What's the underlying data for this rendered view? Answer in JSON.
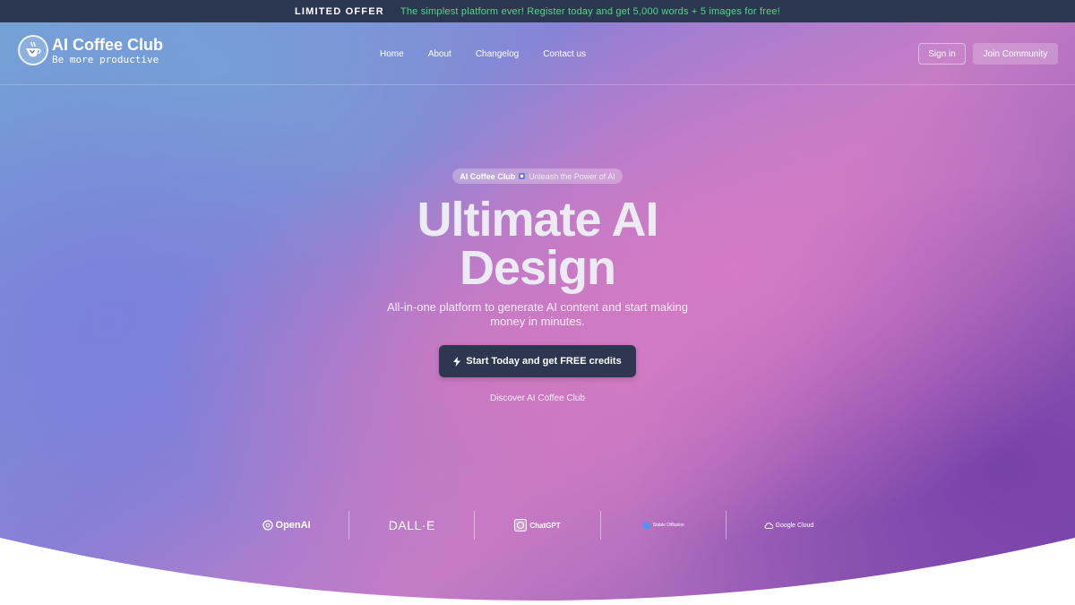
{
  "banner": {
    "offer": "LIMITED OFFER",
    "message": "The simplest platform ever! Register today and get 5,000 words + 5 images for free!"
  },
  "brand": {
    "name": "AI Coffee Club",
    "tagline": "Be more productive"
  },
  "nav": {
    "items": [
      "Home",
      "About",
      "Changelog",
      "Contact us"
    ],
    "sign_in": "Sign in",
    "join": "Join Community"
  },
  "hero": {
    "pill_brand": "AI Coffee Club",
    "pill_text": "Unleash the Power of AI",
    "headline_line1": "Ultimate AI",
    "headline_line2": "Design",
    "subtext": "All-in-one platform to generate AI content and start making money in minutes.",
    "cta": "Start Today and get FREE credits",
    "discover": "Discover AI Coffee Club"
  },
  "partners": {
    "openai": "OpenAI",
    "dalle": "DALL·E",
    "chatgpt": "ChatGPT",
    "stable_diffusion": "Stable Diffusion",
    "google_cloud": "Google Cloud"
  },
  "colors": {
    "banner_bg": "#2b3650",
    "banner_accent": "#4ade80",
    "cta_bg": "#2e3750"
  }
}
